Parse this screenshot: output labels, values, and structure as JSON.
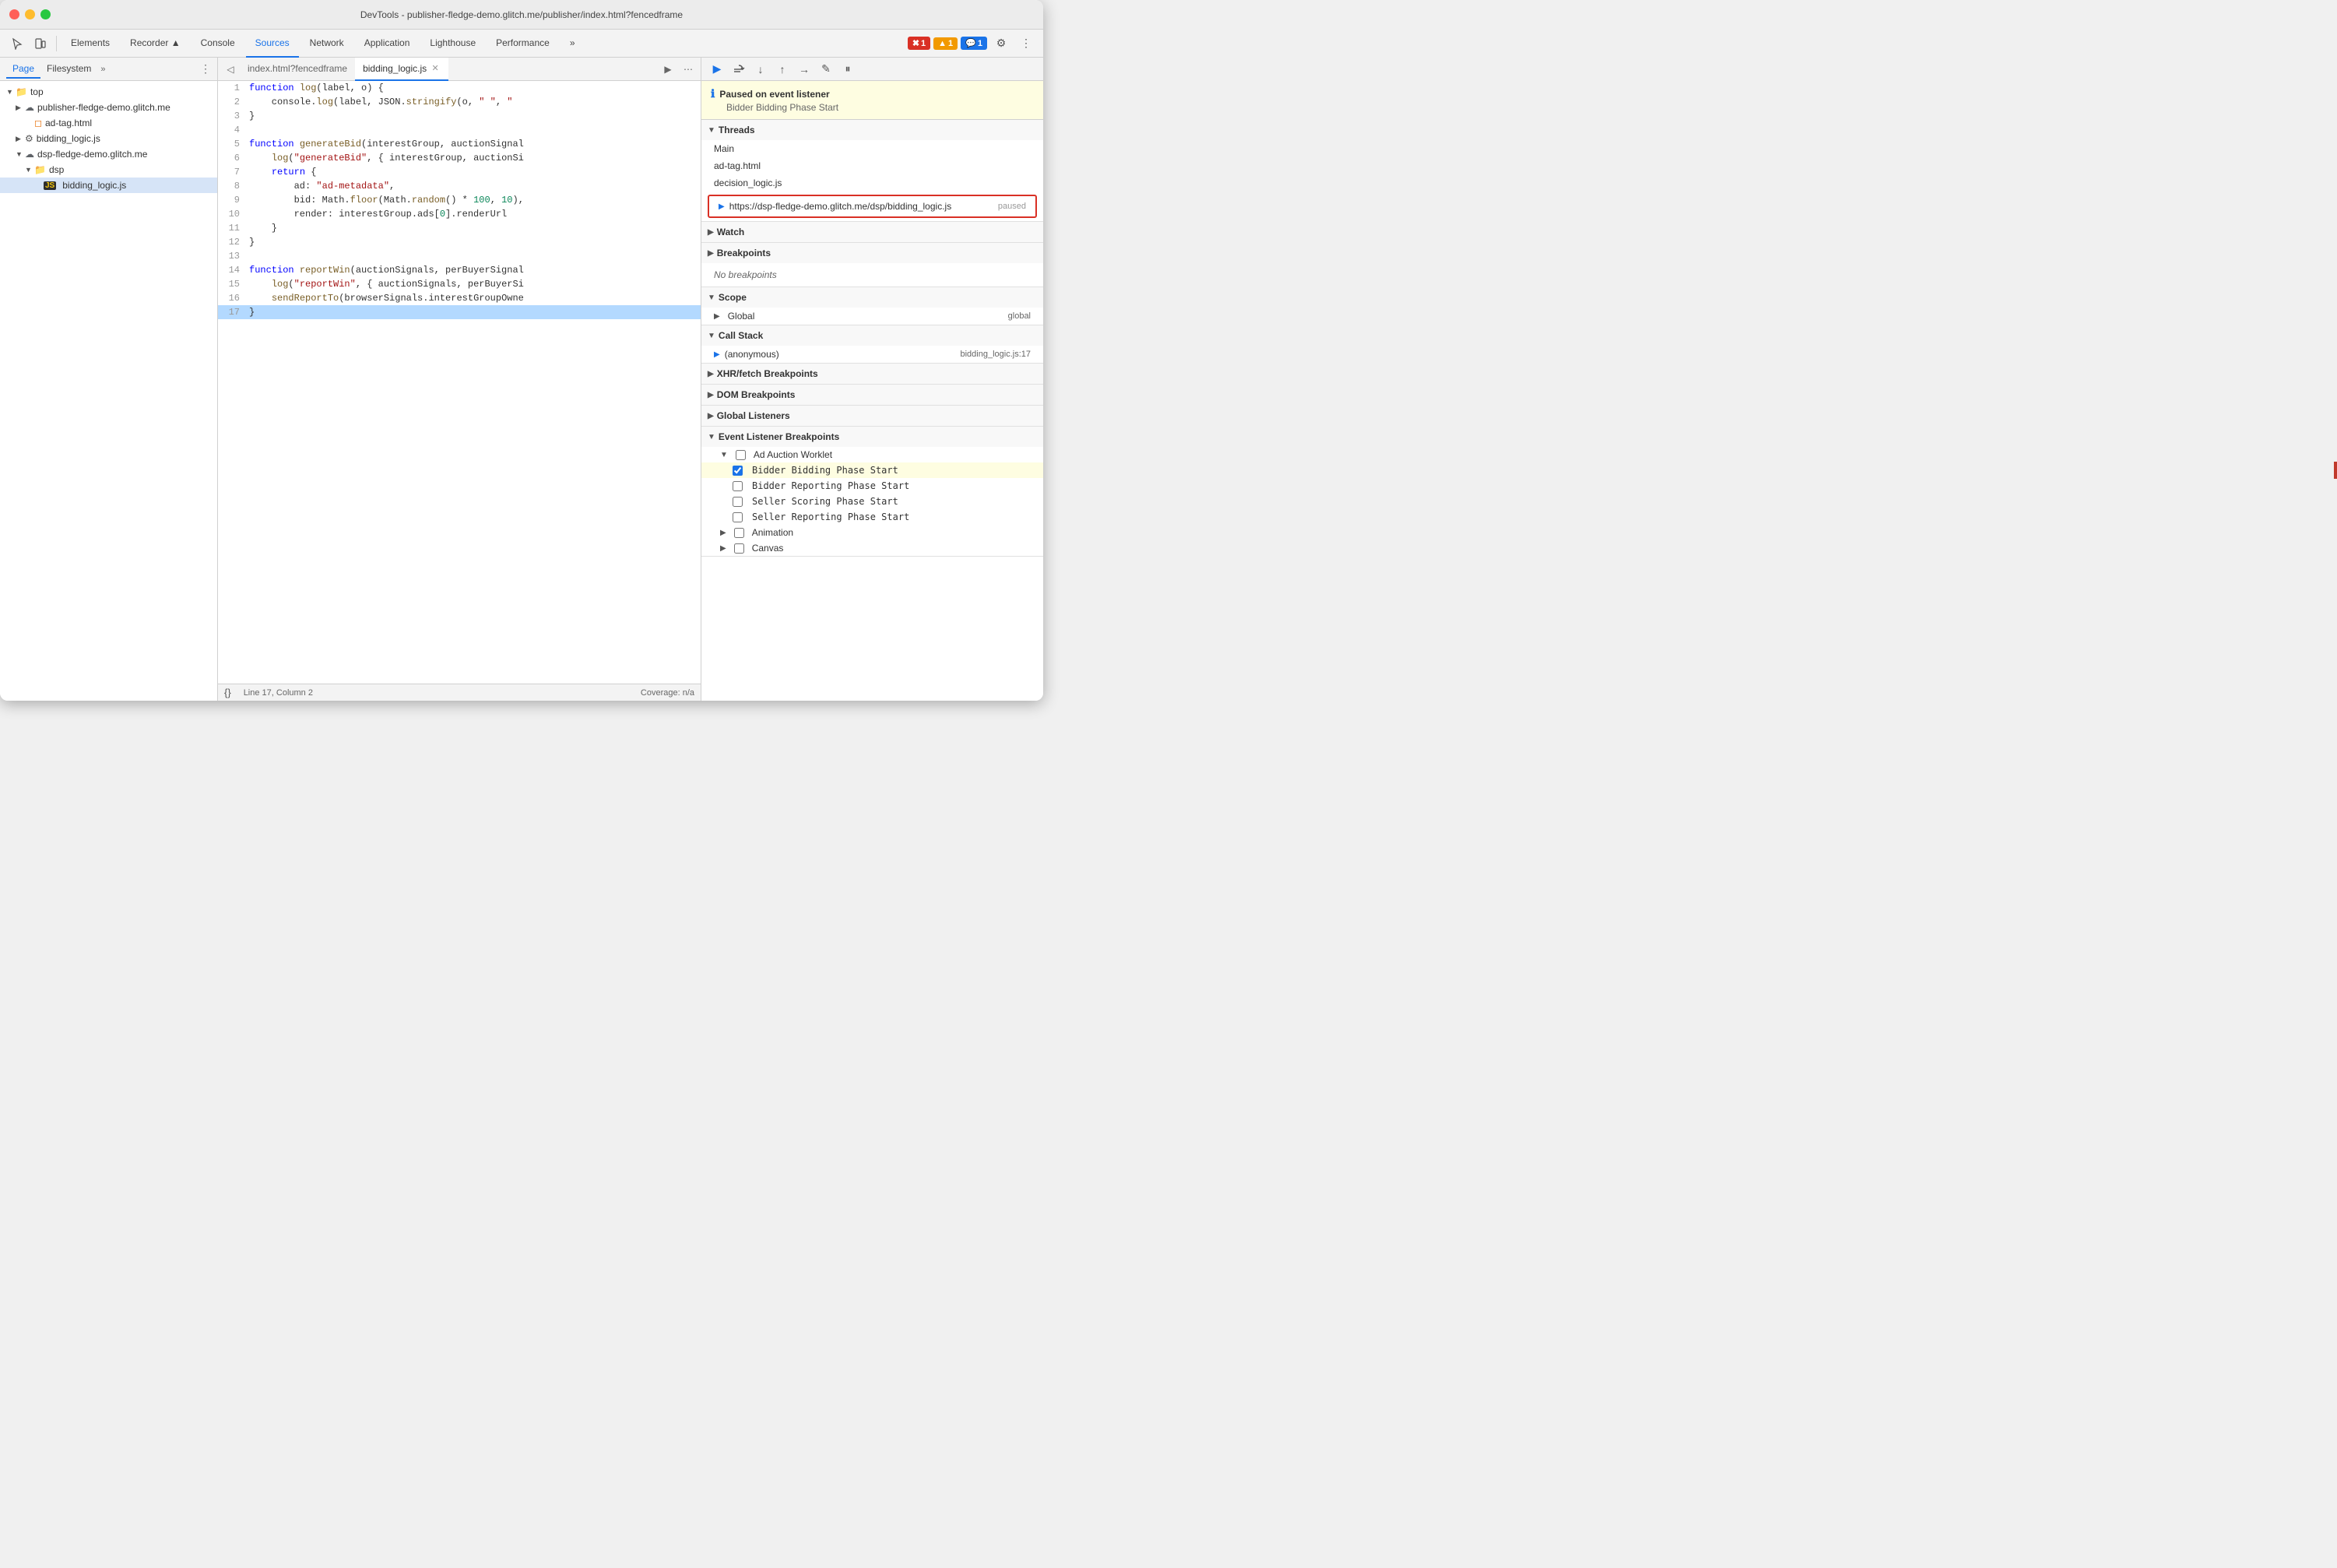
{
  "window": {
    "title": "DevTools - publisher-fledge-demo.glitch.me/publisher/index.html?fencedframe"
  },
  "toolbar": {
    "tabs": [
      {
        "id": "elements",
        "label": "Elements",
        "active": false
      },
      {
        "id": "recorder",
        "label": "Recorder ▲",
        "active": false
      },
      {
        "id": "console",
        "label": "Console",
        "active": false
      },
      {
        "id": "sources",
        "label": "Sources",
        "active": true
      },
      {
        "id": "network",
        "label": "Network",
        "active": false
      },
      {
        "id": "application",
        "label": "Application",
        "active": false
      },
      {
        "id": "lighthouse",
        "label": "Lighthouse",
        "active": false
      },
      {
        "id": "performance",
        "label": "Performance",
        "active": false
      }
    ],
    "badges": {
      "error": "1",
      "warning": "1",
      "info": "1"
    }
  },
  "file_panel": {
    "tabs": [
      {
        "id": "page",
        "label": "Page",
        "active": true
      },
      {
        "id": "filesystem",
        "label": "Filesystem",
        "active": false
      }
    ],
    "tree": [
      {
        "id": "top",
        "label": "top",
        "type": "folder",
        "level": 0,
        "expanded": true
      },
      {
        "id": "publisher",
        "label": "publisher-fledge-demo.glitch.me",
        "type": "cloud",
        "level": 1,
        "expanded": false
      },
      {
        "id": "adtag",
        "label": "ad-tag.html",
        "type": "file-html",
        "level": 1
      },
      {
        "id": "bidding-logic",
        "label": "bidding_logic.js",
        "type": "file-js-gear",
        "level": 1,
        "expanded": false
      },
      {
        "id": "dsp-domain",
        "label": "dsp-fledge-demo.glitch.me",
        "type": "cloud",
        "level": 1,
        "expanded": true
      },
      {
        "id": "dsp-folder",
        "label": "dsp",
        "type": "folder",
        "level": 2,
        "expanded": true
      },
      {
        "id": "bidding-logic-file",
        "label": "bidding_logic.js",
        "type": "file-js-yellow",
        "level": 3,
        "active": true
      }
    ]
  },
  "editor": {
    "tabs": [
      {
        "id": "index-html",
        "label": "index.html?fencedframe",
        "active": false,
        "closeable": false
      },
      {
        "id": "bidding-logic-tab",
        "label": "bidding_logic.js",
        "active": true,
        "closeable": true
      }
    ],
    "code_lines": [
      {
        "num": 1,
        "code": "function log(label, o) {",
        "highlighted": false
      },
      {
        "num": 2,
        "code": "    console.log(label, JSON.stringify(o, \" \", \"",
        "highlighted": false
      },
      {
        "num": 3,
        "code": "}",
        "highlighted": false
      },
      {
        "num": 4,
        "code": "",
        "highlighted": false
      },
      {
        "num": 5,
        "code": "function generateBid(interestGroup, auctionSignal",
        "highlighted": false
      },
      {
        "num": 6,
        "code": "    log(\"generateBid\", { interestGroup, auctionSi",
        "highlighted": false
      },
      {
        "num": 7,
        "code": "    return {",
        "highlighted": false
      },
      {
        "num": 8,
        "code": "        ad: \"ad-metadata\",",
        "highlighted": false
      },
      {
        "num": 9,
        "code": "        bid: Math.floor(Math.random() * 100, 10),",
        "highlighted": false
      },
      {
        "num": 10,
        "code": "        render: interestGroup.ads[0].renderUrl",
        "highlighted": false
      },
      {
        "num": 11,
        "code": "    }",
        "highlighted": false
      },
      {
        "num": 12,
        "code": "}",
        "highlighted": false
      },
      {
        "num": 13,
        "code": "",
        "highlighted": false
      },
      {
        "num": 14,
        "code": "function reportWin(auctionSignals, perBuyerSignal",
        "highlighted": false
      },
      {
        "num": 15,
        "code": "    log(\"reportWin\", { auctionSignals, perBuyerSi",
        "highlighted": false
      },
      {
        "num": 16,
        "code": "    sendReportTo(browserSignals.interestGroupOwne",
        "highlighted": false
      },
      {
        "num": 17,
        "code": "}",
        "highlighted": true
      }
    ],
    "statusbar": {
      "format_icon": "{}",
      "position": "Line 17, Column 2",
      "coverage": "Coverage: n/a"
    }
  },
  "debug_panel": {
    "toolbar_buttons": [
      {
        "id": "resume",
        "icon": "▶",
        "label": "Resume"
      },
      {
        "id": "step-over",
        "icon": "↷",
        "label": "Step over"
      },
      {
        "id": "step-into",
        "icon": "↓",
        "label": "Step into"
      },
      {
        "id": "step-out",
        "icon": "↑",
        "label": "Step out"
      },
      {
        "id": "step",
        "icon": "→",
        "label": "Step"
      },
      {
        "id": "deactivate",
        "icon": "✎",
        "label": "Deactivate breakpoints"
      },
      {
        "id": "pause-exceptions",
        "icon": "⏸",
        "label": "Pause on exceptions"
      }
    ],
    "paused_banner": {
      "title": "Paused on event listener",
      "subtitle": "Bidder Bidding Phase Start"
    },
    "sections": {
      "threads": {
        "label": "Threads",
        "expanded": true,
        "items": [
          {
            "id": "main",
            "label": "Main",
            "type": "normal"
          },
          {
            "id": "ad-tag",
            "label": "ad-tag.html",
            "type": "normal"
          },
          {
            "id": "decision-logic",
            "label": "decision_logic.js",
            "type": "normal"
          },
          {
            "id": "bidding-logic-url",
            "label": "https://dsp-fledge-demo.glitch.me/dsp/bidding_logic.js",
            "paused": "paused",
            "type": "highlighted"
          }
        ]
      },
      "watch": {
        "label": "Watch",
        "expanded": false
      },
      "breakpoints": {
        "label": "Breakpoints",
        "expanded": false,
        "empty_text": "No breakpoints"
      },
      "scope": {
        "label": "Scope",
        "expanded": false
      },
      "global": {
        "label": "Global",
        "expanded": false,
        "value": "global"
      },
      "call_stack": {
        "label": "Call Stack",
        "expanded": true,
        "items": [
          {
            "id": "anonymous",
            "label": "(anonymous)",
            "location": "bidding_logic.js:17"
          }
        ]
      },
      "xhr_breakpoints": {
        "label": "XHR/fetch Breakpoints",
        "expanded": false
      },
      "dom_breakpoints": {
        "label": "DOM Breakpoints",
        "expanded": false
      },
      "global_listeners": {
        "label": "Global Listeners",
        "expanded": false
      },
      "event_listener_breakpoints": {
        "label": "Event Listener Breakpoints",
        "expanded": true,
        "groups": [
          {
            "id": "ad-auction-worklet",
            "label": "Ad Auction Worklet",
            "expanded": true,
            "items": [
              {
                "id": "bidder-bidding-phase",
                "label": "Bidder Bidding Phase Start",
                "checked": true,
                "highlighted": true
              },
              {
                "id": "bidder-reporting-phase",
                "label": "Bidder Reporting Phase Start",
                "checked": false
              },
              {
                "id": "seller-scoring-phase",
                "label": "Seller Scoring Phase Start",
                "checked": false
              },
              {
                "id": "seller-reporting-phase",
                "label": "Seller Reporting Phase Start",
                "checked": false
              }
            ]
          },
          {
            "id": "animation",
            "label": "Animation",
            "expanded": false,
            "items": []
          },
          {
            "id": "canvas",
            "label": "Canvas",
            "expanded": false,
            "items": []
          }
        ]
      }
    }
  }
}
